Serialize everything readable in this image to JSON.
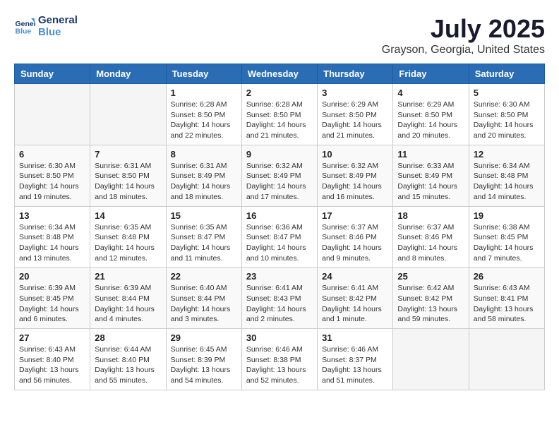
{
  "header": {
    "logo_line1": "General",
    "logo_line2": "Blue",
    "month": "July 2025",
    "location": "Grayson, Georgia, United States"
  },
  "weekdays": [
    "Sunday",
    "Monday",
    "Tuesday",
    "Wednesday",
    "Thursday",
    "Friday",
    "Saturday"
  ],
  "weeks": [
    [
      {
        "day": "",
        "info": ""
      },
      {
        "day": "",
        "info": ""
      },
      {
        "day": "1",
        "info": "Sunrise: 6:28 AM\nSunset: 8:50 PM\nDaylight: 14 hours and 22 minutes."
      },
      {
        "day": "2",
        "info": "Sunrise: 6:28 AM\nSunset: 8:50 PM\nDaylight: 14 hours and 21 minutes."
      },
      {
        "day": "3",
        "info": "Sunrise: 6:29 AM\nSunset: 8:50 PM\nDaylight: 14 hours and 21 minutes."
      },
      {
        "day": "4",
        "info": "Sunrise: 6:29 AM\nSunset: 8:50 PM\nDaylight: 14 hours and 20 minutes."
      },
      {
        "day": "5",
        "info": "Sunrise: 6:30 AM\nSunset: 8:50 PM\nDaylight: 14 hours and 20 minutes."
      }
    ],
    [
      {
        "day": "6",
        "info": "Sunrise: 6:30 AM\nSunset: 8:50 PM\nDaylight: 14 hours and 19 minutes."
      },
      {
        "day": "7",
        "info": "Sunrise: 6:31 AM\nSunset: 8:50 PM\nDaylight: 14 hours and 18 minutes."
      },
      {
        "day": "8",
        "info": "Sunrise: 6:31 AM\nSunset: 8:49 PM\nDaylight: 14 hours and 18 minutes."
      },
      {
        "day": "9",
        "info": "Sunrise: 6:32 AM\nSunset: 8:49 PM\nDaylight: 14 hours and 17 minutes."
      },
      {
        "day": "10",
        "info": "Sunrise: 6:32 AM\nSunset: 8:49 PM\nDaylight: 14 hours and 16 minutes."
      },
      {
        "day": "11",
        "info": "Sunrise: 6:33 AM\nSunset: 8:49 PM\nDaylight: 14 hours and 15 minutes."
      },
      {
        "day": "12",
        "info": "Sunrise: 6:34 AM\nSunset: 8:48 PM\nDaylight: 14 hours and 14 minutes."
      }
    ],
    [
      {
        "day": "13",
        "info": "Sunrise: 6:34 AM\nSunset: 8:48 PM\nDaylight: 14 hours and 13 minutes."
      },
      {
        "day": "14",
        "info": "Sunrise: 6:35 AM\nSunset: 8:48 PM\nDaylight: 14 hours and 12 minutes."
      },
      {
        "day": "15",
        "info": "Sunrise: 6:35 AM\nSunset: 8:47 PM\nDaylight: 14 hours and 11 minutes."
      },
      {
        "day": "16",
        "info": "Sunrise: 6:36 AM\nSunset: 8:47 PM\nDaylight: 14 hours and 10 minutes."
      },
      {
        "day": "17",
        "info": "Sunrise: 6:37 AM\nSunset: 8:46 PM\nDaylight: 14 hours and 9 minutes."
      },
      {
        "day": "18",
        "info": "Sunrise: 6:37 AM\nSunset: 8:46 PM\nDaylight: 14 hours and 8 minutes."
      },
      {
        "day": "19",
        "info": "Sunrise: 6:38 AM\nSunset: 8:45 PM\nDaylight: 14 hours and 7 minutes."
      }
    ],
    [
      {
        "day": "20",
        "info": "Sunrise: 6:39 AM\nSunset: 8:45 PM\nDaylight: 14 hours and 6 minutes."
      },
      {
        "day": "21",
        "info": "Sunrise: 6:39 AM\nSunset: 8:44 PM\nDaylight: 14 hours and 4 minutes."
      },
      {
        "day": "22",
        "info": "Sunrise: 6:40 AM\nSunset: 8:44 PM\nDaylight: 14 hours and 3 minutes."
      },
      {
        "day": "23",
        "info": "Sunrise: 6:41 AM\nSunset: 8:43 PM\nDaylight: 14 hours and 2 minutes."
      },
      {
        "day": "24",
        "info": "Sunrise: 6:41 AM\nSunset: 8:42 PM\nDaylight: 14 hours and 1 minute."
      },
      {
        "day": "25",
        "info": "Sunrise: 6:42 AM\nSunset: 8:42 PM\nDaylight: 13 hours and 59 minutes."
      },
      {
        "day": "26",
        "info": "Sunrise: 6:43 AM\nSunset: 8:41 PM\nDaylight: 13 hours and 58 minutes."
      }
    ],
    [
      {
        "day": "27",
        "info": "Sunrise: 6:43 AM\nSunset: 8:40 PM\nDaylight: 13 hours and 56 minutes."
      },
      {
        "day": "28",
        "info": "Sunrise: 6:44 AM\nSunset: 8:40 PM\nDaylight: 13 hours and 55 minutes."
      },
      {
        "day": "29",
        "info": "Sunrise: 6:45 AM\nSunset: 8:39 PM\nDaylight: 13 hours and 54 minutes."
      },
      {
        "day": "30",
        "info": "Sunrise: 6:46 AM\nSunset: 8:38 PM\nDaylight: 13 hours and 52 minutes."
      },
      {
        "day": "31",
        "info": "Sunrise: 6:46 AM\nSunset: 8:37 PM\nDaylight: 13 hours and 51 minutes."
      },
      {
        "day": "",
        "info": ""
      },
      {
        "day": "",
        "info": ""
      }
    ]
  ]
}
